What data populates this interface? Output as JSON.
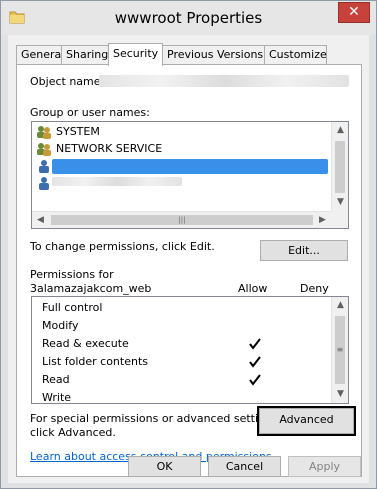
{
  "window": {
    "title": "wwwroot Properties"
  },
  "tabs": [
    "General",
    "Sharing",
    "Security",
    "Previous Versions",
    "Customize"
  ],
  "security": {
    "object_name_label": "Object name:",
    "groups_label": "Group or user names:",
    "groups": [
      {
        "name": "SYSTEM"
      },
      {
        "name": "NETWORK SERVICE"
      },
      {
        "name": ""
      },
      {
        "name": ""
      }
    ],
    "change_note": "To change permissions, click Edit.",
    "edit_button": "Edit...",
    "permissions_for_label": "Permissions for",
    "permissions_for_name": "3alamazajakcom_web",
    "allow_header": "Allow",
    "deny_header": "Deny",
    "permissions": [
      {
        "name": "Full control",
        "allow": false,
        "deny": false
      },
      {
        "name": "Modify",
        "allow": false,
        "deny": false
      },
      {
        "name": "Read & execute",
        "allow": true,
        "deny": false
      },
      {
        "name": "List folder contents",
        "allow": true,
        "deny": false
      },
      {
        "name": "Read",
        "allow": true,
        "deny": false
      },
      {
        "name": "Write",
        "allow": false,
        "deny": false
      }
    ],
    "special_note_line1": "For special permissions or advanced settings,",
    "special_note_line2": "click Advanced.",
    "advanced_button": "Advanced",
    "learn_link": "Learn about access control and permissions"
  },
  "footer": {
    "ok": "OK",
    "cancel": "Cancel",
    "apply": "Apply"
  },
  "colors": {
    "selection": "#3a8fe8",
    "close": "#c7423a",
    "link": "#0066cc"
  },
  "icons": {
    "folder": "folder-icon",
    "group": "group-users-icon",
    "user": "user-icon",
    "check": "checkmark-icon"
  }
}
